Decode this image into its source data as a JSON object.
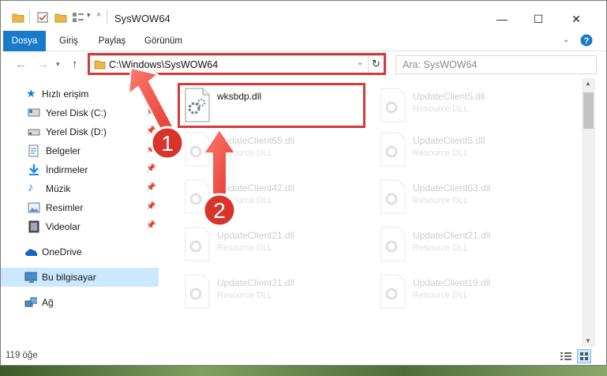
{
  "window": {
    "title": "SysWOW64"
  },
  "window_controls": {
    "minimize": "—",
    "maximize": "☐",
    "close": "✕"
  },
  "ribbon": {
    "tabs": [
      {
        "label": "Dosya"
      },
      {
        "label": "Giriş"
      },
      {
        "label": "Paylaş"
      },
      {
        "label": "Görünüm"
      }
    ]
  },
  "address": {
    "path": "C:\\Windows\\SysWOW64",
    "search_placeholder": "Ara: SysWOW64"
  },
  "navigation": {
    "quick_access": "Hızlı erişim",
    "items": [
      {
        "label": "Yerel Disk (C:)",
        "icon": "drive-icon",
        "pinned": true
      },
      {
        "label": "Yerel Disk (D:)",
        "icon": "drive-icon",
        "pinned": true
      },
      {
        "label": "Belgeler",
        "icon": "documents-icon",
        "pinned": true
      },
      {
        "label": "İndirmeler",
        "icon": "downloads-icon",
        "pinned": true
      },
      {
        "label": "Müzik",
        "icon": "music-icon",
        "pinned": true
      },
      {
        "label": "Resimler",
        "icon": "pictures-icon",
        "pinned": true
      },
      {
        "label": "Videolar",
        "icon": "videos-icon",
        "pinned": true
      }
    ],
    "onedrive": "OneDrive",
    "this_pc": "Bu bilgisayar",
    "network": "Ağ"
  },
  "files": {
    "selected": {
      "name": "wksbdp.dll"
    },
    "left_column": [
      {
        "name": "UpdateClient65.dll",
        "type": "Resource DLL"
      },
      {
        "name": "UpdateClient42.dll",
        "type": "Resource DLL"
      },
      {
        "name": "UpdateClient21.dll",
        "type": "Resource DLL"
      },
      {
        "name": "UpdateClient21.dll",
        "type": "Resource DLL"
      }
    ],
    "right_column": [
      {
        "name": "UpdateClient5.dll",
        "type": "Resource DLL"
      },
      {
        "name": "UpdateClient5.dll",
        "type": "Resource DLL"
      },
      {
        "name": "UpdateClient63.dll",
        "type": "Resource DLL"
      },
      {
        "name": "UpdateClient21.dll",
        "type": "Resource DLL"
      },
      {
        "name": "UpdateClient19.dll",
        "type": "Resource DLL"
      }
    ]
  },
  "status": {
    "item_count": "119 öğe"
  },
  "annotations": {
    "step1": "1",
    "step2": "2"
  },
  "colors": {
    "accent": "#1979ca",
    "highlight": "#d43a3a",
    "selection": "#cce8ff"
  }
}
